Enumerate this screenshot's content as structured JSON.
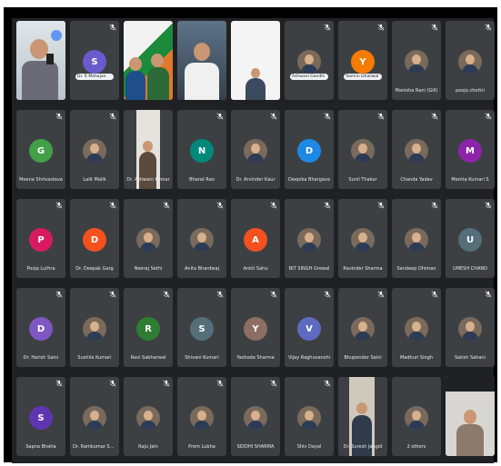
{
  "meeting": {
    "rows": [
      {
        "tiles": [
          {
            "kind": "video",
            "name": "",
            "scene": "man-glasses-phone",
            "active": true,
            "muted": false
          },
          {
            "kind": "letter",
            "letter": "S",
            "color": "#6a5acd",
            "name": "Dr. R Mahajan",
            "name_style": "pill",
            "muted": true
          },
          {
            "kind": "video",
            "name": "",
            "scene": "banner-men",
            "muted": false
          },
          {
            "kind": "video",
            "name": "",
            "scene": "man-office",
            "muted": false
          },
          {
            "kind": "video",
            "name": "",
            "scene": "small-man",
            "muted": false
          },
          {
            "kind": "photo",
            "name": "Ashwani Gandhi",
            "name_style": "pill",
            "muted": true
          },
          {
            "kind": "letter",
            "letter": "Y",
            "color": "#f57c00",
            "name": "Yasmin Dhaliwal",
            "name_style": "pill",
            "muted": true
          },
          {
            "kind": "photo",
            "name": "Manisha Rani (Gill)",
            "muted": true
          },
          {
            "kind": "photo",
            "name": "pooja chettri",
            "muted": true
          }
        ]
      },
      {
        "tiles": [
          {
            "kind": "letter",
            "letter": "G",
            "color": "#43a047",
            "name": "Meena Shrivastava",
            "muted": true
          },
          {
            "kind": "photo",
            "name": "Lalit Malik",
            "muted": true
          },
          {
            "kind": "video",
            "name": "Dr. Ashwani Kumar",
            "scene": "standing-man",
            "muted": false
          },
          {
            "kind": "letter",
            "letter": "N",
            "color": "#00897b",
            "name": "Bharat Rao",
            "muted": true
          },
          {
            "kind": "photo",
            "name": "Dr. Arvinder Kaur",
            "muted": true
          },
          {
            "kind": "letter",
            "letter": "D",
            "color": "#1e88e5",
            "name": "Deepika Bhargava",
            "muted": true
          },
          {
            "kind": "photo",
            "name": "Sunil Thakur",
            "muted": true
          },
          {
            "kind": "photo",
            "name": "Chanda Yadav",
            "muted": true
          },
          {
            "kind": "letter",
            "letter": "M",
            "color": "#8e24aa",
            "name": "Mamta Kumari S",
            "muted": true
          }
        ]
      },
      {
        "tiles": [
          {
            "kind": "letter",
            "letter": "P",
            "color": "#d81b60",
            "name": "Pooja Luthra",
            "muted": true
          },
          {
            "kind": "letter",
            "letter": "D",
            "color": "#f4511e",
            "name": "Dr. Deepak Garg",
            "muted": true
          },
          {
            "kind": "photo",
            "name": "Neeraj Sethi",
            "muted": true
          },
          {
            "kind": "photo",
            "name": "Anita Bhardwaj",
            "muted": true
          },
          {
            "kind": "letter",
            "letter": "A",
            "color": "#f4511e",
            "name": "Ankit Sahu",
            "muted": true
          },
          {
            "kind": "photo",
            "name": "NIT SINGH Grewal",
            "muted": true
          },
          {
            "kind": "photo",
            "name": "Ravinder Sharma",
            "muted": true
          },
          {
            "kind": "photo",
            "name": "Sandeep Dhiman",
            "muted": true
          },
          {
            "kind": "letter",
            "letter": "U",
            "color": "#546e7a",
            "name": "UMESH CHAND",
            "muted": true
          }
        ]
      },
      {
        "tiles": [
          {
            "kind": "letter",
            "letter": "D",
            "color": "#7e57c2",
            "name": "Dr. Harish Saini",
            "muted": true
          },
          {
            "kind": "photo",
            "name": "Sushila Kumari",
            "muted": true
          },
          {
            "kind": "letter",
            "letter": "R",
            "color": "#2e7d32",
            "name": "Ravi Sabharwal",
            "muted": true
          },
          {
            "kind": "letter",
            "letter": "S",
            "color": "#546e7a",
            "name": "Shivani Kumari",
            "muted": true
          },
          {
            "kind": "letter",
            "letter": "Y",
            "color": "#8d6e63",
            "name": "Yashoda Sharma",
            "muted": true
          },
          {
            "kind": "letter",
            "letter": "V",
            "color": "#5c6bc0",
            "name": "Vijay Raghuvanshi",
            "muted": true
          },
          {
            "kind": "photo",
            "name": "Bhupender Saini",
            "muted": true
          },
          {
            "kind": "photo",
            "name": "Madhuri Singh",
            "muted": true
          },
          {
            "kind": "photo",
            "name": "Satish Sahani",
            "muted": true
          }
        ]
      },
      {
        "tiles": [
          {
            "kind": "letter",
            "letter": "S",
            "color": "#5e35b1",
            "name": "Sapna Bhatia",
            "muted": true
          },
          {
            "kind": "photo",
            "name": "Dr. Ramkumar Sharma",
            "muted": true
          },
          {
            "kind": "photo",
            "name": "Raju Jain",
            "muted": true
          },
          {
            "kind": "photo",
            "name": "Prem Lubha",
            "muted": true
          },
          {
            "kind": "photo",
            "name": "SIDDHI SHARMA",
            "muted": true
          },
          {
            "kind": "photo",
            "name": "Shiv Dayal",
            "muted": true
          },
          {
            "kind": "video",
            "name": "Dr. Suresh Jangid",
            "scene": "standing-man-2",
            "muted": false
          },
          {
            "kind": "photo",
            "name": "2 others",
            "muted": false
          },
          {
            "kind": "video",
            "name": "",
            "scene": "self-view",
            "muted": false
          }
        ]
      }
    ]
  }
}
